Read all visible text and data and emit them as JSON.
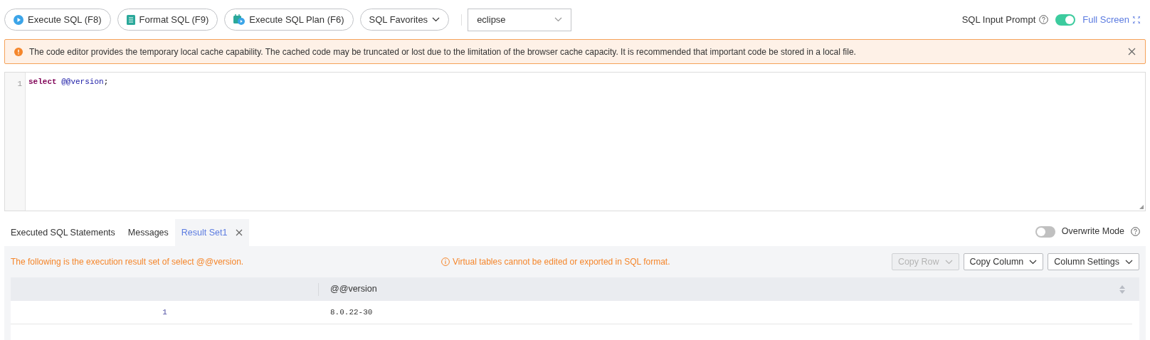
{
  "toolbar": {
    "buttons": [
      {
        "label": "Execute SQL (F8)",
        "kind": "play"
      },
      {
        "label": "Format SQL (F9)",
        "kind": "format"
      },
      {
        "label": "Execute SQL Plan (F6)",
        "kind": "plan"
      },
      {
        "label": "SQL Favorites",
        "kind": "dropdown"
      }
    ],
    "theme_select": {
      "value": "eclipse"
    },
    "sql_input_prompt": {
      "label": "SQL Input Prompt",
      "on": true
    },
    "full_screen": "Full Screen"
  },
  "alert": {
    "text": "The code editor provides the temporary local cache capability. The cached code may be truncated or lost due to the limitation of the browser cache capacity. It is recommended that important code be stored in a local file."
  },
  "editor": {
    "lines": [
      {
        "number": "1",
        "tokens": [
          {
            "text": "select",
            "kind": "keyword"
          },
          {
            "text": "@@version",
            "kind": "variable"
          },
          {
            "text": ";",
            "kind": "punctuation"
          }
        ]
      }
    ]
  },
  "result_tabs": [
    {
      "label": "Executed SQL Statements",
      "selected": false,
      "closable": false
    },
    {
      "label": "Messages",
      "selected": false,
      "closable": false
    },
    {
      "label": "Result Set1",
      "selected": true,
      "closable": true
    }
  ],
  "overwrite_mode": {
    "label": "Overwrite Mode",
    "on": false
  },
  "result": {
    "summary": "The following is the execution result set of select @@version.",
    "warning": "Virtual tables cannot be edited or exported in SQL format.",
    "actions": [
      {
        "label": "Copy Row",
        "disabled": true
      },
      {
        "label": "Copy Column",
        "disabled": false
      },
      {
        "label": "Column Settings",
        "disabled": false
      }
    ],
    "table": {
      "columns": [
        "@@version"
      ],
      "rows": [
        {
          "index": "1",
          "cells": [
            "8.0.22-30"
          ]
        }
      ]
    }
  }
}
